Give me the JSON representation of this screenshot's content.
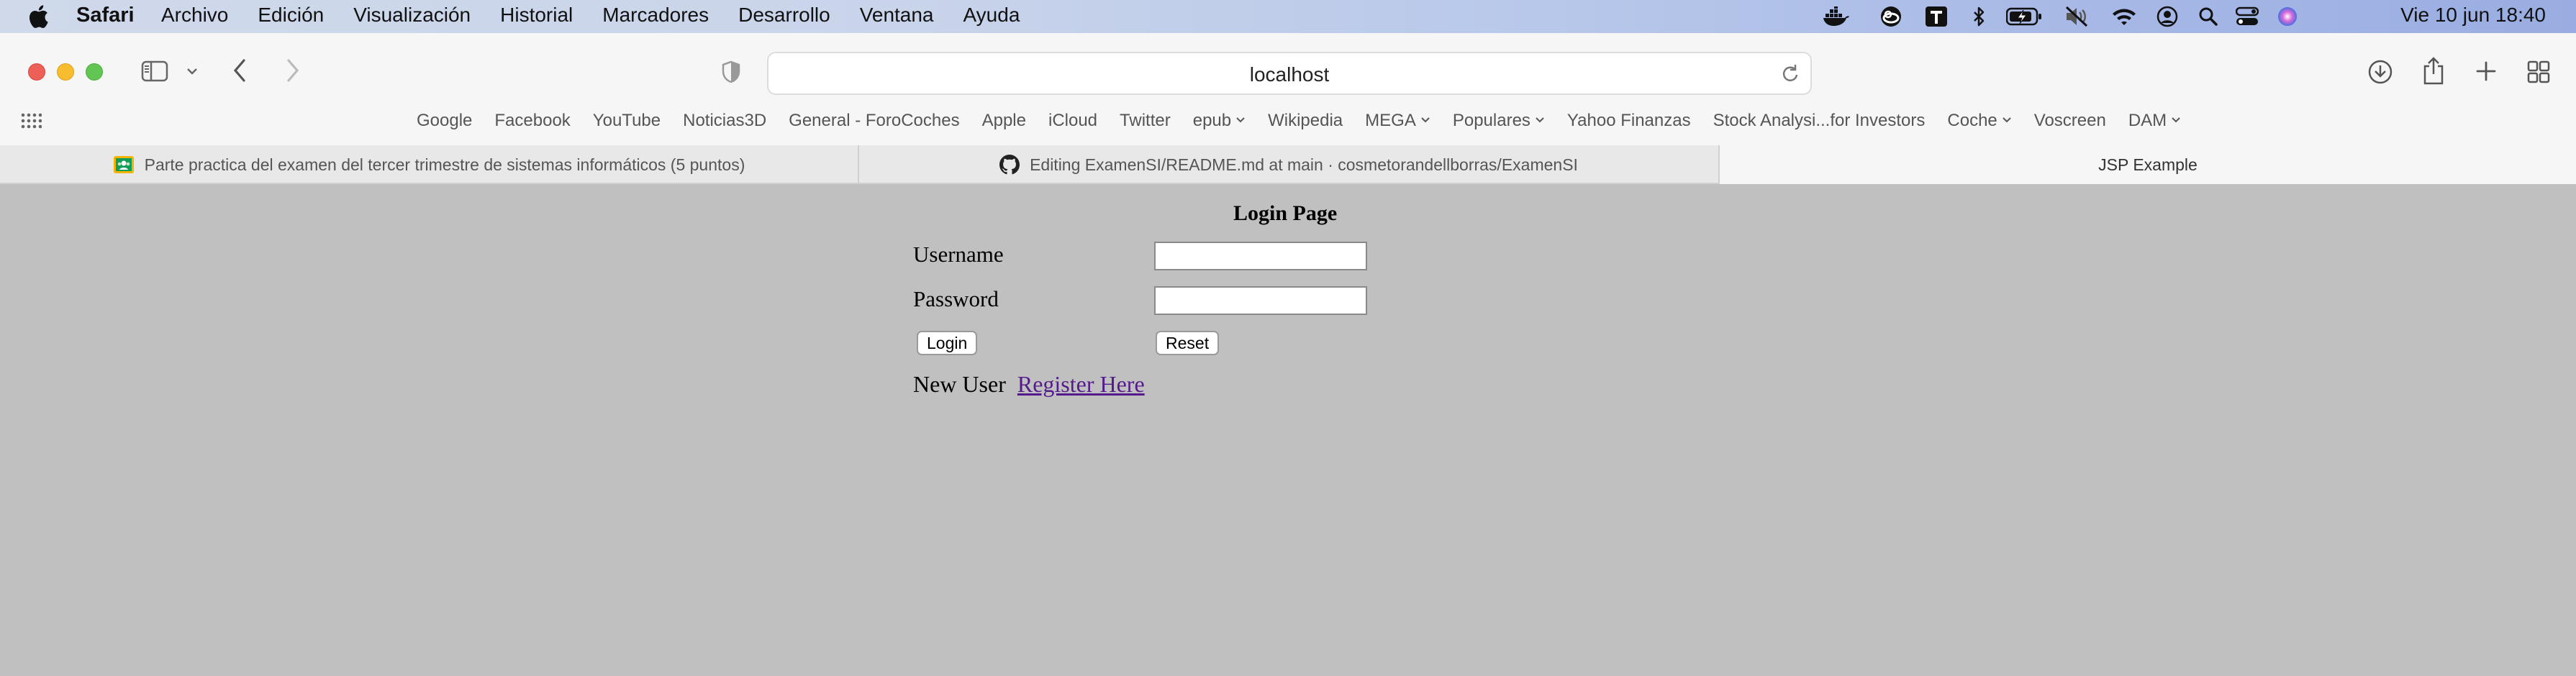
{
  "menubar": {
    "app_name": "Safari",
    "menus": [
      "Archivo",
      "Edición",
      "Visualización",
      "Historial",
      "Marcadores",
      "Desarrollo",
      "Ventana",
      "Ayuda"
    ],
    "status_icons": [
      "docker-icon",
      "creative-cloud-icon",
      "typora-icon",
      "bluetooth-icon",
      "battery-icon",
      "mute-icon",
      "wifi-icon",
      "user-icon",
      "spotlight-icon",
      "control-center-icon",
      "siri-icon"
    ],
    "clock": "Vie 10 jun  18:40"
  },
  "toolbar": {
    "url": "localhost"
  },
  "favorites": [
    {
      "label": "Google",
      "menu": false
    },
    {
      "label": "Facebook",
      "menu": false
    },
    {
      "label": "YouTube",
      "menu": false
    },
    {
      "label": "Noticias3D",
      "menu": false
    },
    {
      "label": "General - ForoCoches",
      "menu": false
    },
    {
      "label": "Apple",
      "menu": false
    },
    {
      "label": "iCloud",
      "menu": false
    },
    {
      "label": "Twitter",
      "menu": false
    },
    {
      "label": "epub",
      "menu": true
    },
    {
      "label": "Wikipedia",
      "menu": false
    },
    {
      "label": "MEGA",
      "menu": true
    },
    {
      "label": "Populares",
      "menu": true
    },
    {
      "label": "Yahoo Finanzas",
      "menu": false
    },
    {
      "label": "Stock Analysi...for Investors",
      "menu": false
    },
    {
      "label": "Coche",
      "menu": true
    },
    {
      "label": "Voscreen",
      "menu": false
    },
    {
      "label": "DAM",
      "menu": true
    }
  ],
  "tabs": [
    {
      "title": "Parte practica del examen del tercer trimestre de sistemas informáticos (5 puntos)",
      "icon": "classroom-icon",
      "active": false
    },
    {
      "title": "Editing ExamenSI/README.md at main · cosmetorandellborras/ExamenSI",
      "icon": "github-icon",
      "active": false
    },
    {
      "title": "JSP Example",
      "icon": "",
      "active": true
    }
  ],
  "page": {
    "title": "Login Page",
    "username_label": "Username",
    "password_label": "Password",
    "username_value": "",
    "password_value": "",
    "login_button": "Login",
    "reset_button": "Reset",
    "new_user_text": "New User",
    "register_link": "Register Here"
  }
}
